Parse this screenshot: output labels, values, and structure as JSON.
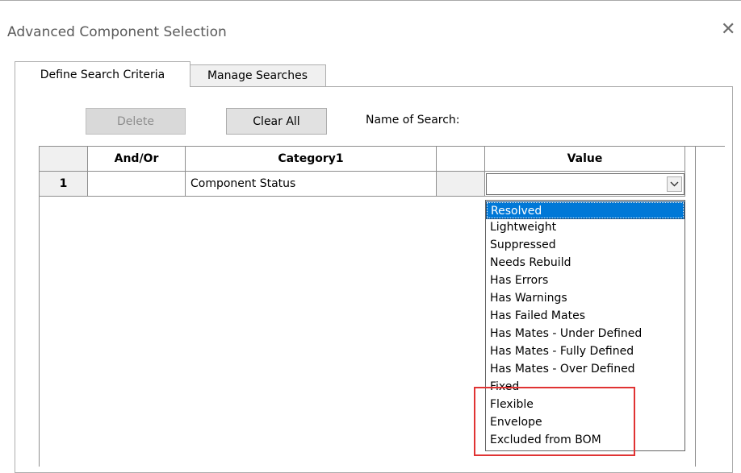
{
  "window": {
    "title": "Advanced Component Selection",
    "close_glyph": "✕"
  },
  "tabs": [
    {
      "label": "Define Search Criteria",
      "active": true
    },
    {
      "label": "Manage Searches",
      "active": false
    }
  ],
  "toolbar": {
    "delete_label": "Delete",
    "clear_all_label": "Clear All",
    "name_of_search_label": "Name of Search:"
  },
  "grid": {
    "columns": [
      "",
      "And/Or",
      "Category1",
      "",
      "Value"
    ],
    "rows": [
      {
        "number": "1",
        "and_or": "",
        "category": "Component Status",
        "extra": "",
        "value": ""
      }
    ]
  },
  "value_dropdown": {
    "selected": "Resolved",
    "options": [
      "Resolved",
      "Lightweight",
      "Suppressed",
      "Needs Rebuild",
      "Has Errors",
      "Has Warnings",
      "Has Failed Mates",
      "Has Mates - Under Defined",
      "Has Mates - Fully Defined",
      "Has Mates - Over Defined",
      "Fixed",
      "Flexible",
      "Envelope",
      "Excluded from BOM"
    ]
  },
  "colors": {
    "selection": "#0078d7",
    "highlight_box": "#e03333"
  }
}
